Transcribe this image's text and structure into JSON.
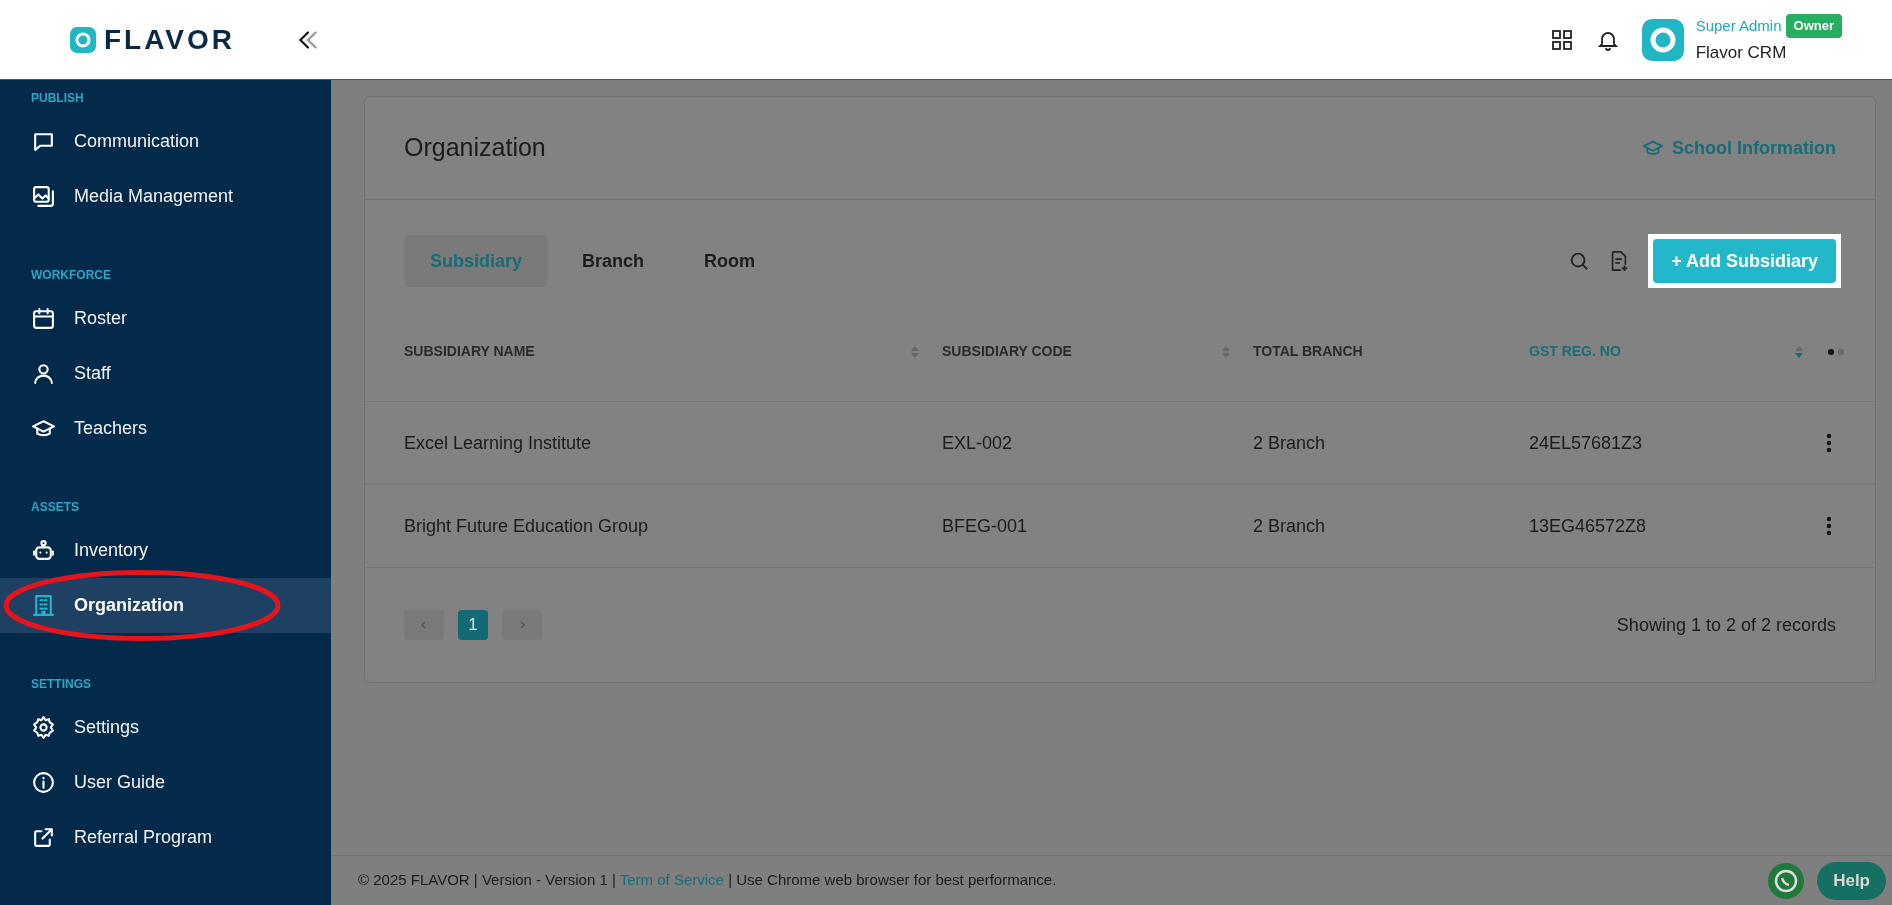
{
  "header": {
    "logo": "FLAVOR",
    "user_name": "Super Admin",
    "role_badge": "Owner",
    "org_name": "Flavor CRM"
  },
  "sidebar": {
    "sections": [
      {
        "title": "PUBLISH",
        "items": [
          {
            "label": "Communication",
            "selected": false
          },
          {
            "label": "Media Management",
            "selected": false
          }
        ]
      },
      {
        "title": "WORKFORCE",
        "items": [
          {
            "label": "Roster",
            "selected": false
          },
          {
            "label": "Staff",
            "selected": false
          },
          {
            "label": "Teachers",
            "selected": false
          }
        ]
      },
      {
        "title": "ASSETS",
        "items": [
          {
            "label": "Inventory",
            "selected": false
          },
          {
            "label": "Organization",
            "selected": true
          }
        ]
      },
      {
        "title": "SETTINGS",
        "items": [
          {
            "label": "Settings",
            "selected": false
          },
          {
            "label": "User Guide",
            "selected": false
          },
          {
            "label": "Referral Program",
            "selected": false
          }
        ]
      }
    ]
  },
  "page": {
    "title": "Organization",
    "link": "School Information",
    "tabs": [
      {
        "label": "Subsidiary",
        "selected": true
      },
      {
        "label": "Branch",
        "selected": false
      },
      {
        "label": "Room",
        "selected": false
      }
    ],
    "add_button": "+ Add Subsidiary",
    "table": {
      "columns": [
        {
          "label": "SUBSIDIARY NAME",
          "sortable": true,
          "sorted": false
        },
        {
          "label": "SUBSIDIARY CODE",
          "sortable": true,
          "sorted": false
        },
        {
          "label": "TOTAL BRANCH",
          "sortable": false,
          "sorted": false
        },
        {
          "label": "GST REG. NO",
          "sortable": true,
          "sorted": true
        }
      ],
      "rows": [
        [
          "Excel Learning Institute",
          "EXL-002",
          "2 Branch",
          "24EL57681Z3"
        ],
        [
          "Bright Future Education Group",
          "BFEG-001",
          "2 Branch",
          "13EG46572Z8"
        ]
      ]
    },
    "pagination": {
      "pages": [
        {
          "label": "1",
          "selected": true
        }
      ],
      "summary": "Showing 1 to 2 of 2 records"
    }
  },
  "footer": {
    "before": "© 2025 FLAVOR | Version - Version 1 |",
    "link": "Term of Service",
    "after": "| Use Chrome web browser for best performance.",
    "help": "Help"
  }
}
